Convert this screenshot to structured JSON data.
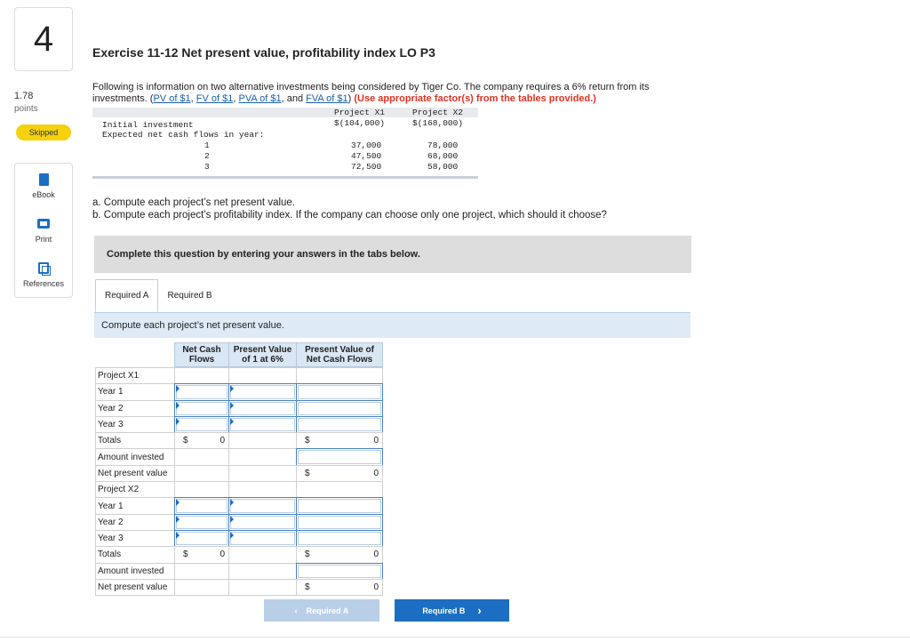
{
  "left_rail": {
    "question_number": "4",
    "points_value": "1.78",
    "points_label": "points",
    "status_badge": "Skipped",
    "tools": [
      {
        "label": "eBook",
        "icon": "book-icon"
      },
      {
        "label": "Print",
        "icon": "print-icon"
      },
      {
        "label": "References",
        "icon": "references-icon"
      }
    ]
  },
  "title": "Exercise 11-12 Net present value, profitability index LO P3",
  "intro": {
    "line1": "Following is information on two alternative investments being considered by Tiger Co. The company requires a 6% return from its",
    "line2_prefix": "investments. (",
    "links": [
      "PV of $1",
      "FV of $1",
      "PVA of $1",
      "FVA of $1"
    ],
    "sep1": ", ",
    "sep2": ", ",
    "sep3": ", and ",
    "line2_suffix": ") ",
    "emphasis": "(Use appropriate factor(s) from the tables provided.)"
  },
  "investments": {
    "col_headers": [
      "Project X1",
      "Project X2"
    ],
    "initial_label": "Initial investment",
    "initial_values": [
      "$(104,000)",
      "$(168,000)"
    ],
    "flows_label": "Expected net cash flows in year:",
    "years": [
      "1",
      "2",
      "3"
    ],
    "x1_flows": [
      "37,000",
      "47,500",
      "72,500"
    ],
    "x2_flows": [
      "78,000",
      "68,000",
      "58,000"
    ]
  },
  "questions": {
    "a": "a. Compute each project’s net present value.",
    "b": "b. Compute each project’s profitability index. If the company can choose only one project, which should it choose?"
  },
  "banner": "Complete this question by entering your answers in the tabs below.",
  "tabs": [
    "Required A",
    "Required B"
  ],
  "instruction": "Compute each project’s net present value.",
  "table": {
    "headers": [
      "Net Cash\nFlows",
      "Present Value\nof 1 at 6%",
      "Present Value of\nNet Cash Flows"
    ],
    "row_labels": [
      "Project X1",
      "Year 1",
      "Year 2",
      "Year 3",
      "Totals",
      "Amount invested",
      "Net present value",
      "Project X2",
      "Year 1",
      "Year 2",
      "Year 3",
      "Totals",
      "Amount invested",
      "Net present value"
    ],
    "currency": "$",
    "zero": "0"
  },
  "nav": {
    "prev_label": "Required A",
    "next_label": "Required B",
    "prev_icon": "chevron-left-icon",
    "next_icon": "chevron-right-icon"
  }
}
